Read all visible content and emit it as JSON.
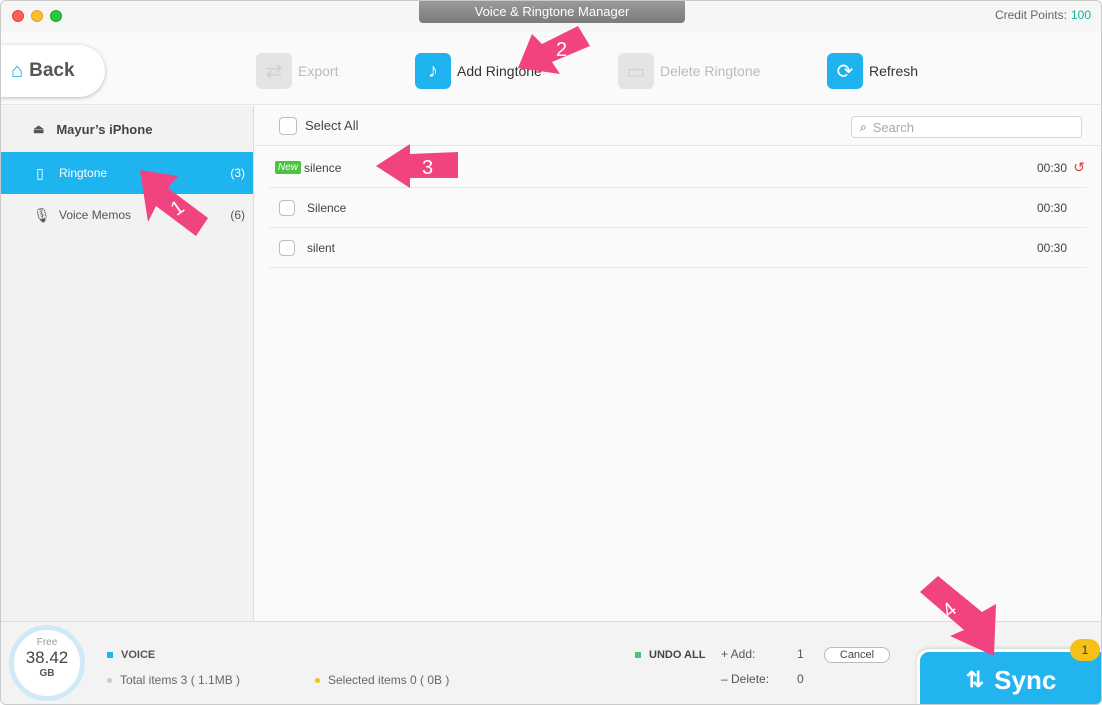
{
  "window": {
    "title": "Voice & Ringtone Manager"
  },
  "credit": {
    "label": "Credit Points:",
    "value": "100"
  },
  "toolbar": {
    "back_label": "Back",
    "export_label": "Export",
    "add_label": "Add Ringtone",
    "delete_label": "Delete Ringtone",
    "refresh_label": "Refresh"
  },
  "sidebar": {
    "device_name": "Mayur’s iPhone",
    "items": [
      {
        "label": "Ringtone",
        "count": "(3)",
        "icon": "phone-icon",
        "selected": true
      },
      {
        "label": "Voice Memos",
        "count": "(6)",
        "icon": "microphone-icon",
        "selected": false
      }
    ]
  },
  "list": {
    "select_all": "Select All",
    "search_placeholder": "Search",
    "rows": [
      {
        "name": "silence",
        "duration": "00:30",
        "new_badge": "New",
        "undo": true
      },
      {
        "name": "Silence",
        "duration": "00:30"
      },
      {
        "name": "silent",
        "duration": "00:30"
      }
    ]
  },
  "bottom": {
    "storage_free_label": "Free",
    "storage_value": "38.42",
    "storage_unit": "GB",
    "voice_label": "VOICE",
    "total_items": "Total items 3 ( 1.1MB )",
    "selected_items": "Selected items 0 ( 0B )",
    "undo_all": "UNDO ALL",
    "add_label": "+ Add:",
    "add_value": "1",
    "delete_label": "– Delete:",
    "delete_value": "0",
    "cancel_label": "Cancel",
    "sync_label": "Sync",
    "sync_badge": "1"
  },
  "annotations": [
    "1",
    "2",
    "3",
    "4"
  ],
  "colors": {
    "accent": "#1db4ef",
    "arrow": "#f0437f",
    "new_badge": "#4bc43f",
    "badge": "#f5c118"
  }
}
